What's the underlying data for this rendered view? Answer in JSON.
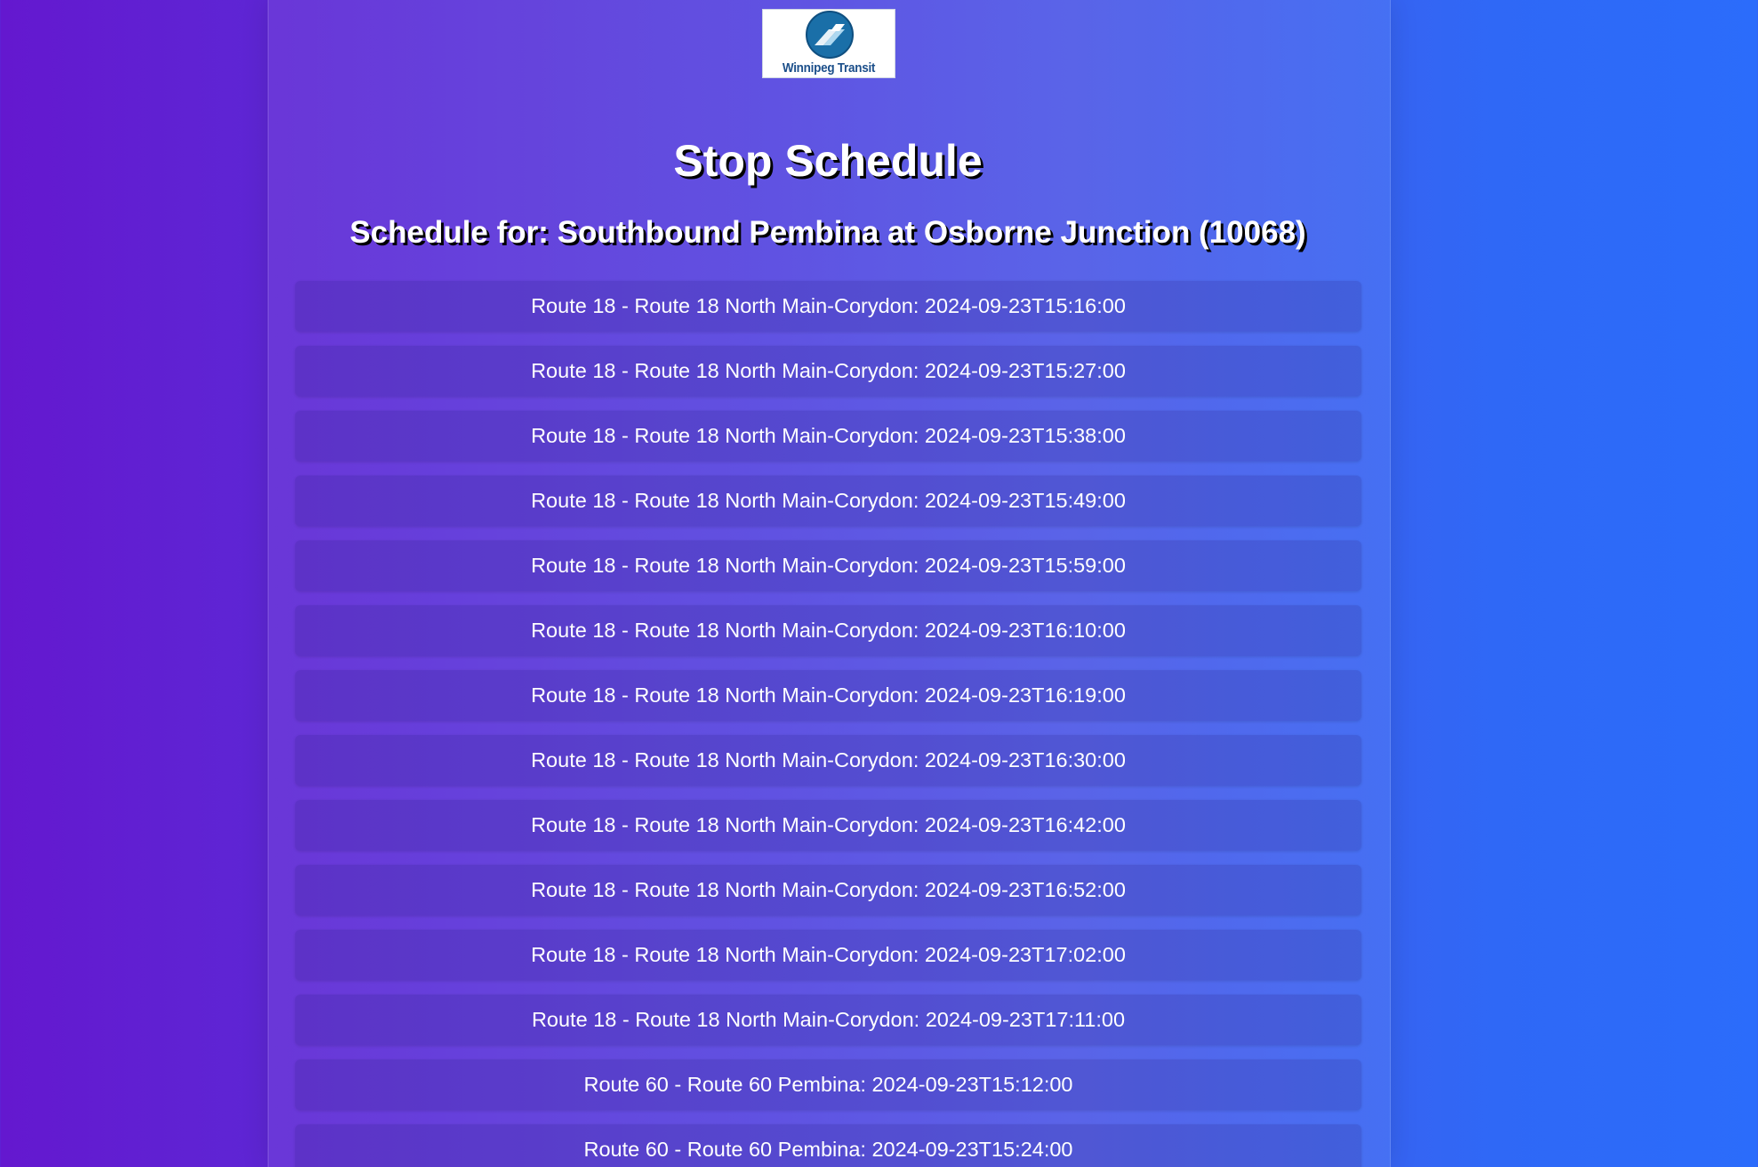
{
  "logo": {
    "alt_text": "Winnipeg Transit",
    "icon": "winnipeg-transit-logo-icon"
  },
  "page": {
    "title": "Stop Schedule",
    "schedule_heading": "Schedule for: Southbound Pembina at Osborne Junction (10068)"
  },
  "schedule": [
    "Route 18 - Route 18 North Main-Corydon: 2024-09-23T15:16:00",
    "Route 18 - Route 18 North Main-Corydon: 2024-09-23T15:27:00",
    "Route 18 - Route 18 North Main-Corydon: 2024-09-23T15:38:00",
    "Route 18 - Route 18 North Main-Corydon: 2024-09-23T15:49:00",
    "Route 18 - Route 18 North Main-Corydon: 2024-09-23T15:59:00",
    "Route 18 - Route 18 North Main-Corydon: 2024-09-23T16:10:00",
    "Route 18 - Route 18 North Main-Corydon: 2024-09-23T16:19:00",
    "Route 18 - Route 18 North Main-Corydon: 2024-09-23T16:30:00",
    "Route 18 - Route 18 North Main-Corydon: 2024-09-23T16:42:00",
    "Route 18 - Route 18 North Main-Corydon: 2024-09-23T16:52:00",
    "Route 18 - Route 18 North Main-Corydon: 2024-09-23T17:02:00",
    "Route 18 - Route 18 North Main-Corydon: 2024-09-23T17:11:00",
    "Route 60 - Route 60 Pembina: 2024-09-23T15:12:00",
    "Route 60 - Route 60 Pembina: 2024-09-23T15:24:00"
  ],
  "colors": {
    "gradient_start": "#6418cf",
    "gradient_end": "#2b6cfb",
    "text": "#ffffff"
  }
}
